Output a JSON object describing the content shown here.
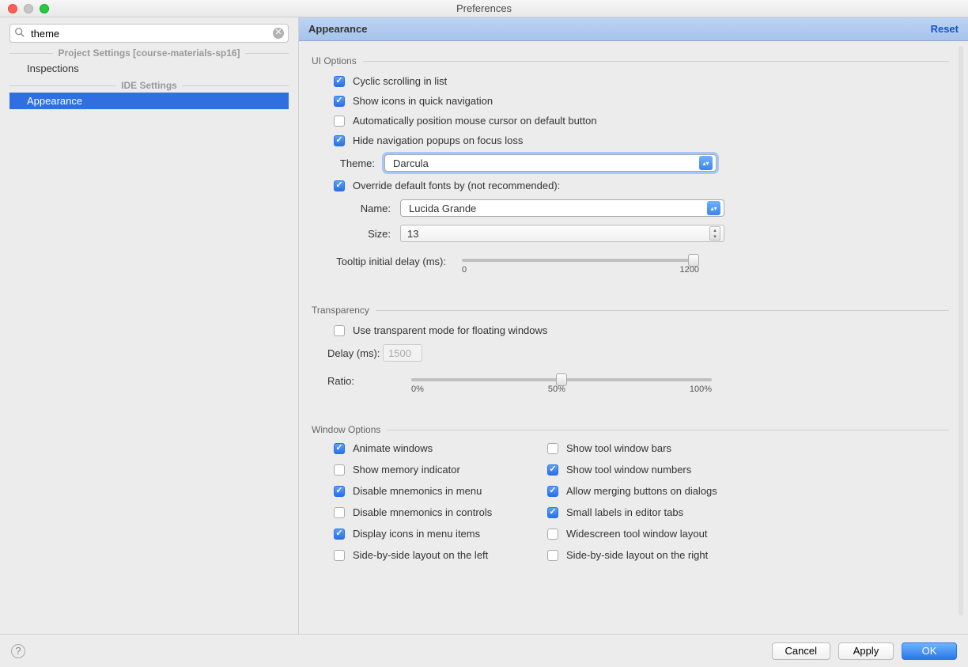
{
  "window": {
    "title": "Preferences"
  },
  "search": {
    "value": "theme"
  },
  "sidebar": {
    "section1": "Project Settings [course-materials-sp16]",
    "items1": [
      {
        "label": "Inspections"
      }
    ],
    "section2": "IDE Settings",
    "items2": [
      {
        "label": "Appearance"
      }
    ]
  },
  "header": {
    "title": "Appearance",
    "reset": "Reset"
  },
  "ui_options": {
    "title": "UI Options",
    "cyclic": "Cyclic scrolling in list",
    "show_icons": "Show icons in quick navigation",
    "auto_cursor": "Automatically position mouse cursor on default button",
    "hide_nav": "Hide navigation popups on focus loss",
    "theme_label": "Theme:",
    "theme_value": "Darcula",
    "override_fonts": "Override default fonts by (not recommended):",
    "name_label": "Name:",
    "name_value": "Lucida Grande",
    "size_label": "Size:",
    "size_value": "13",
    "tooltip_label": "Tooltip initial delay (ms):",
    "tooltip_min": "0",
    "tooltip_max": "1200"
  },
  "transparency": {
    "title": "Transparency",
    "use_transparent": "Use transparent mode for floating windows",
    "delay_label": "Delay (ms):",
    "delay_value": "1500",
    "ratio_label": "Ratio:",
    "ratio_0": "0%",
    "ratio_50": "50%",
    "ratio_100": "100%"
  },
  "window_options": {
    "title": "Window Options",
    "left": [
      {
        "label": "Animate windows",
        "checked": true
      },
      {
        "label": "Show memory indicator",
        "checked": false
      },
      {
        "label": "Disable mnemonics in menu",
        "checked": true
      },
      {
        "label": "Disable mnemonics in controls",
        "checked": false
      },
      {
        "label": "Display icons in menu items",
        "checked": true
      },
      {
        "label": "Side-by-side layout on the left",
        "checked": false
      }
    ],
    "right": [
      {
        "label": "Show tool window bars",
        "checked": false
      },
      {
        "label": "Show tool window numbers",
        "checked": true
      },
      {
        "label": "Allow merging buttons on dialogs",
        "checked": true
      },
      {
        "label": "Small labels in editor tabs",
        "checked": true
      },
      {
        "label": "Widescreen tool window layout",
        "checked": false
      },
      {
        "label": "Side-by-side layout on the right",
        "checked": false
      }
    ]
  },
  "footer": {
    "cancel": "Cancel",
    "apply": "Apply",
    "ok": "OK"
  }
}
